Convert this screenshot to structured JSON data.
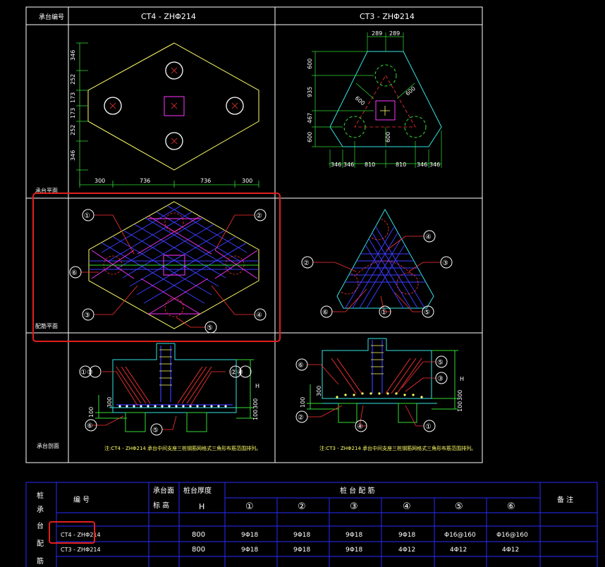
{
  "drawing": {
    "header": {
      "col0": "承台编号",
      "col1": "CT4 - ZHΦ214",
      "col2": "CT3 - ZHΦ214"
    },
    "row_labels": {
      "plan": "承台平面",
      "rebar": "配筋平面",
      "section": "承台剖面"
    },
    "ct4_plan_dims": {
      "left": [
        "346",
        "252",
        "173",
        "173",
        "252",
        "346"
      ],
      "bottom": [
        "300",
        "736",
        "736",
        "300"
      ]
    },
    "ct3_plan_dims": {
      "top": [
        "289",
        "289"
      ],
      "left": [
        "600",
        "935",
        "467",
        "600"
      ],
      "diag": [
        "600",
        "600"
      ],
      "center": "600",
      "bottom": [
        "346",
        "346",
        "810",
        "810",
        "346",
        "346"
      ]
    },
    "markers": [
      "①",
      "②",
      "③",
      "④",
      "⑤",
      "⑥"
    ],
    "section_labels": {
      "ct4_left": "①③",
      "ct4_right": "②④",
      "h": "H",
      "d300": "300",
      "d100": "100"
    },
    "notes": {
      "ct4": "注:CT4 - ZHΦ214 承台中间支座三桩钢筋网格式三角形布筋范围排列。",
      "ct3": "注:CT3 - ZHΦ214 承台中间支座三桩钢筋网格式三角形布筋范围排列。"
    }
  },
  "table": {
    "side_label": [
      "桩",
      "承",
      "台",
      "配",
      "筋"
    ],
    "headers": {
      "code": "编    号",
      "elevation": "承台面\n标  高",
      "thickness": "桩台厚度",
      "thickness_unit": "H",
      "rebar": "桩    台    配    筋",
      "remarks": "备    注"
    },
    "rebar_cols": [
      "①",
      "②",
      "③",
      "④",
      "⑤",
      "⑥"
    ],
    "rows": [
      {
        "code": "CT4 - ZHΦ214",
        "elev": "",
        "h": "800",
        "r": [
          "9Φ18",
          "9Φ18",
          "9Φ18",
          "9Φ18",
          "Φ16@160",
          "Φ16@160"
        ],
        "note": ""
      },
      {
        "code": "CT3 - ZHΦ214",
        "elev": "",
        "h": "800",
        "r": [
          "9Φ18",
          "9Φ18",
          "9Φ18",
          "4Φ12",
          "4Φ12",
          "4Φ12"
        ],
        "note": ""
      }
    ]
  },
  "highlights": {
    "color": "#e0201c"
  },
  "colors": {
    "frame": "#ffffff",
    "outline": "#ffff66",
    "cyan": "#33e5e5",
    "magenta": "#ff33ff",
    "red": "#ff3333",
    "blue": "#3333ff",
    "green": "#33dd33",
    "table": "#2a2aff"
  }
}
